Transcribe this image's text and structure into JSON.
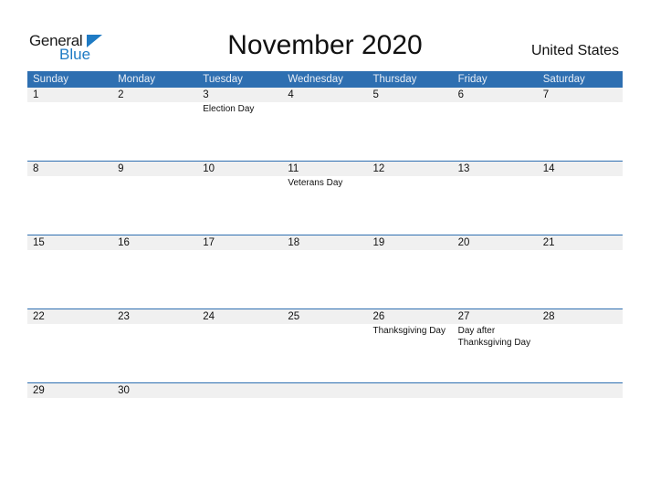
{
  "logo": {
    "line1": "General",
    "line2": "Blue"
  },
  "title": "November 2020",
  "country": "United States",
  "colors": {
    "header_bg": "#2e6fb1",
    "date_row_bg": "#f0f0f0",
    "brand_blue": "#1f7bc4"
  },
  "weekdays": [
    "Sunday",
    "Monday",
    "Tuesday",
    "Wednesday",
    "Thursday",
    "Friday",
    "Saturday"
  ],
  "weeks": [
    {
      "dates": [
        "1",
        "2",
        "3",
        "4",
        "5",
        "6",
        "7"
      ],
      "events": [
        "",
        "",
        "Election Day",
        "",
        "",
        "",
        ""
      ]
    },
    {
      "dates": [
        "8",
        "9",
        "10",
        "11",
        "12",
        "13",
        "14"
      ],
      "events": [
        "",
        "",
        "",
        "Veterans Day",
        "",
        "",
        ""
      ]
    },
    {
      "dates": [
        "15",
        "16",
        "17",
        "18",
        "19",
        "20",
        "21"
      ],
      "events": [
        "",
        "",
        "",
        "",
        "",
        "",
        ""
      ]
    },
    {
      "dates": [
        "22",
        "23",
        "24",
        "25",
        "26",
        "27",
        "28"
      ],
      "events": [
        "",
        "",
        "",
        "",
        "Thanksgiving Day",
        "Day after Thanksgiving Day",
        ""
      ]
    },
    {
      "dates": [
        "29",
        "30",
        "",
        "",
        "",
        "",
        ""
      ],
      "events": [
        "",
        "",
        "",
        "",
        "",
        "",
        ""
      ]
    }
  ]
}
